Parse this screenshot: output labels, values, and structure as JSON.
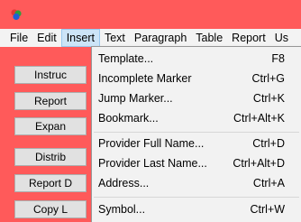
{
  "colors": {
    "window_background": "#ff5a5a",
    "menubar_background": "#f3f3f3",
    "menu_active_background": "#cce4f7",
    "dropdown_background": "#f2f2f2"
  },
  "app_icon": "app-logo-icon",
  "menubar": {
    "items": [
      {
        "label": "File"
      },
      {
        "label": "Edit"
      },
      {
        "label": "Insert",
        "active": true
      },
      {
        "label": "Text"
      },
      {
        "label": "Paragraph"
      },
      {
        "label": "Table"
      },
      {
        "label": "Report"
      },
      {
        "label": "Us"
      }
    ]
  },
  "side_buttons": [
    {
      "label": "Instruc"
    },
    {
      "label": "Report"
    },
    {
      "label": "Expan"
    },
    {
      "label": "Distrib"
    },
    {
      "label": "Report D"
    },
    {
      "label": "Copy L"
    }
  ],
  "insert_menu": {
    "groups": [
      [
        {
          "label": "Template...",
          "shortcut": "F8"
        },
        {
          "label": "Incomplete Marker",
          "shortcut": "Ctrl+G"
        },
        {
          "label": "Jump Marker...",
          "shortcut": "Ctrl+K"
        },
        {
          "label": "Bookmark...",
          "shortcut": "Ctrl+Alt+K"
        }
      ],
      [
        {
          "label": "Provider Full Name...",
          "shortcut": "Ctrl+D"
        },
        {
          "label": "Provider Last Name...",
          "shortcut": "Ctrl+Alt+D"
        },
        {
          "label": "Address...",
          "shortcut": "Ctrl+A"
        }
      ],
      [
        {
          "label": "Symbol...",
          "shortcut": "Ctrl+W"
        }
      ]
    ]
  }
}
